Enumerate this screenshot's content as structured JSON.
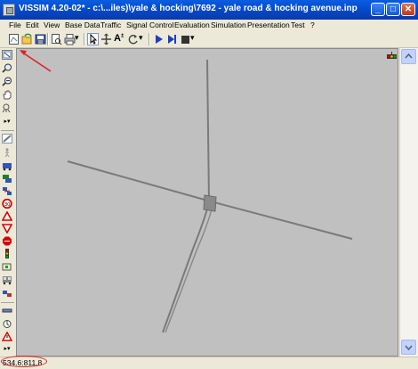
{
  "window": {
    "title": "VISSIM 4.20-02* - c:\\...iles)\\yale & hocking\\7692 - yale road & hocking avenue.inp",
    "minimize_glyph": "_",
    "maximize_glyph": "□",
    "close_glyph": "✕"
  },
  "menu": {
    "items": [
      {
        "label": "File"
      },
      {
        "label": "Edit"
      },
      {
        "label": "View"
      },
      {
        "label": "Base Data"
      },
      {
        "label": "Traffic"
      },
      {
        "label": "Signal Control"
      },
      {
        "label": "Evaluation"
      },
      {
        "label": "Simulation"
      },
      {
        "label": "Presentation"
      },
      {
        "label": "Test"
      },
      {
        "label": "?"
      }
    ]
  },
  "toolbar": {
    "icons": [
      "new-network-icon",
      "open-icon",
      "save-icon",
      "print-preview-icon",
      "print-icon",
      "select-pointer-icon",
      "pan-network-icon",
      "label-text-icon",
      "rotate-icon",
      "run-continuous-icon",
      "single-step-icon",
      "stop-icon"
    ],
    "text_tool_label": "A",
    "text_tool_superscript": "±",
    "dropdown_glyph": "▾"
  },
  "left_toolbar": {
    "icons": [
      "zoom-window-icon",
      "zoom-in-icon",
      "zoom-out-icon",
      "pan-hand-icon",
      "previous-view-icon",
      "scroll-more-icon",
      "links-connectors-icon",
      "pedestrian-icon",
      "vehicle-inputs-icon",
      "routes-icon",
      "speed-decision-icon",
      "reduced-speed-icon",
      "priority-rule-icon",
      "stop-sign-icon",
      "signal-head-icon",
      "detector-icon",
      "transit-stop-icon",
      "node-icon",
      "data-collection-icon",
      "parking-icon",
      "warning-icon"
    ],
    "more_glyph": "▸▾"
  },
  "colors": {
    "titlebar": "#0548c8",
    "canvas_background": "#c0c0c0",
    "road": "#7a7a7a",
    "annotation": "#e02020"
  },
  "status": {
    "coordinates": "534.6:811.8"
  }
}
